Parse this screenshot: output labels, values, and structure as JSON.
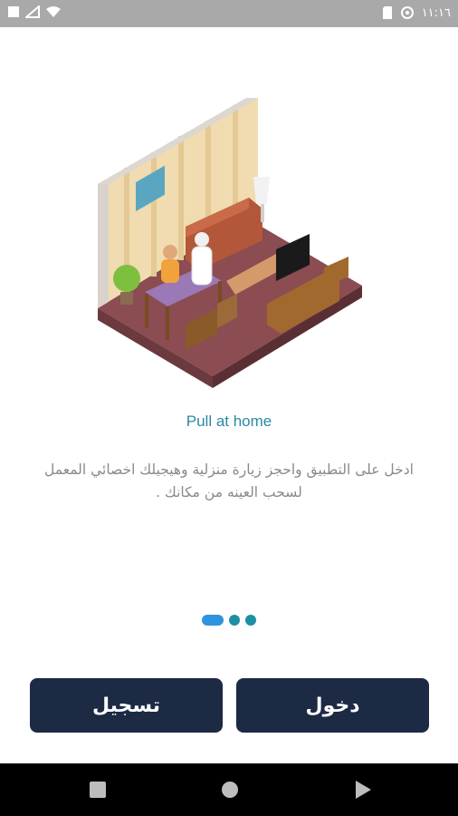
{
  "status_bar": {
    "time": "١١:١٦",
    "icons": [
      "notification-icon",
      "signal-icon",
      "wifi-icon",
      "sim-card-icon",
      "data-saver-icon"
    ]
  },
  "onboarding": {
    "title": "Pull at home",
    "description": "ادخل على التطبيق واحجز زيارة منزلية وهيجيلك اخصائي المعمل لسحب العينه من مكانك .",
    "pager": {
      "total": 3,
      "active_index": 0
    }
  },
  "buttons": {
    "register_label": "تسجيل",
    "login_label": "دخول"
  },
  "colors": {
    "title": "#2b8aa3",
    "button_bg": "#1c2a44",
    "pager_active": "#2e94e0",
    "pager_inactive": "#1c8fa6"
  },
  "nav_bar": {
    "icons": [
      "recent-apps-icon",
      "home-icon",
      "back-icon"
    ]
  }
}
